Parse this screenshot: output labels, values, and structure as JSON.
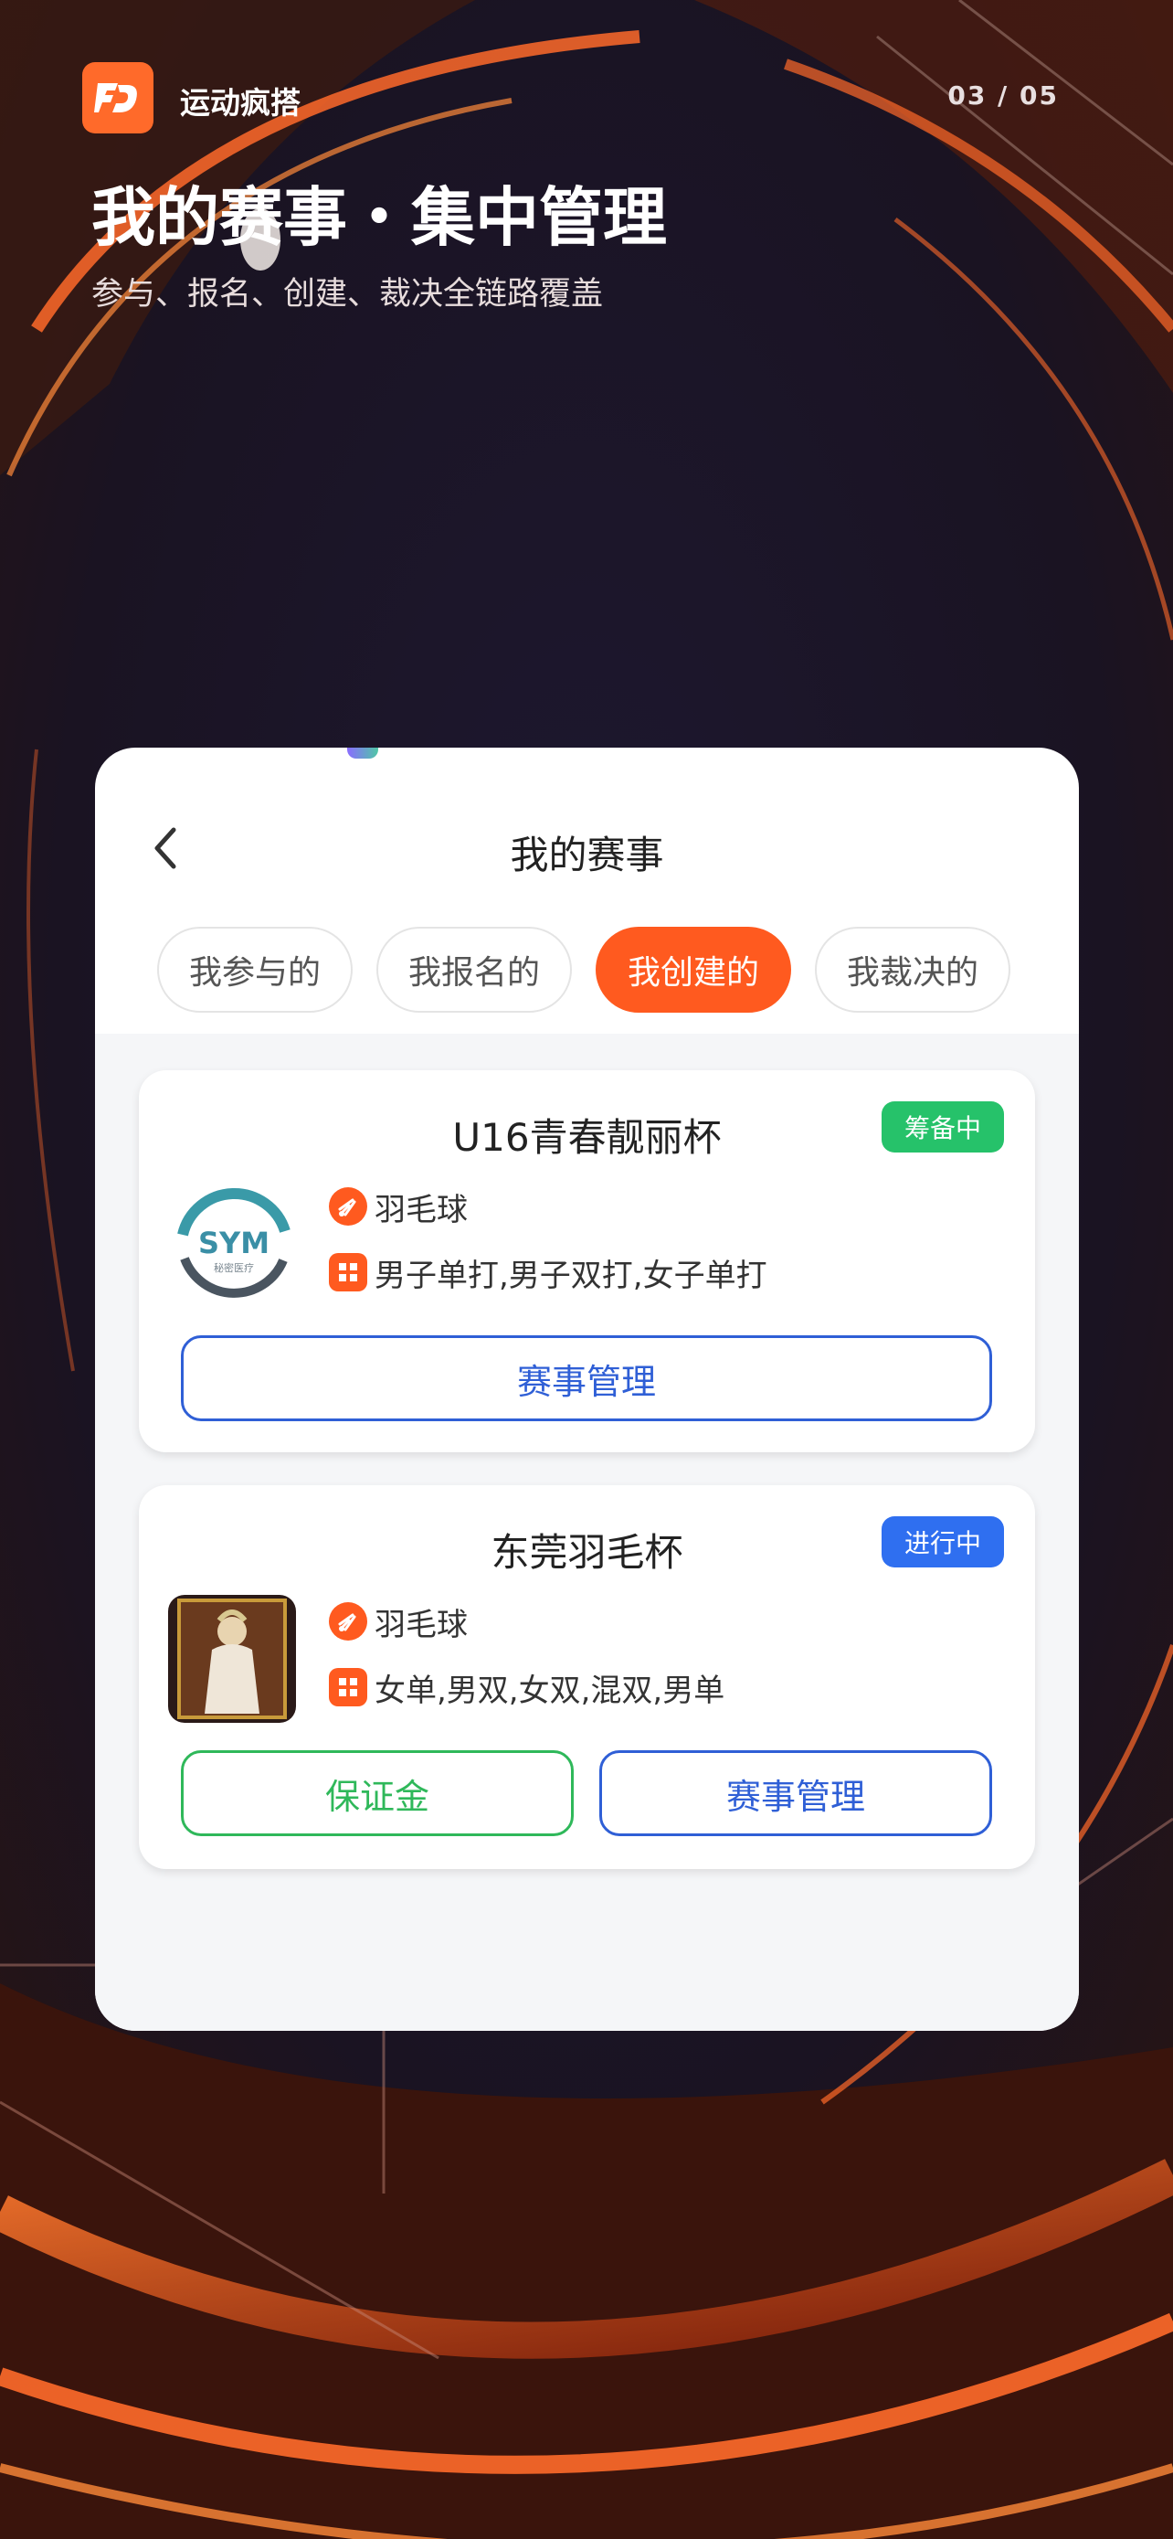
{
  "header": {
    "app_name": "运动疯搭",
    "page_indicator": "03 / 05",
    "title": "我的赛事・集中管理",
    "subtitle": "参与、报名、创建、裁决全链路覆盖"
  },
  "screen": {
    "title": "我的赛事",
    "tabs": [
      {
        "label": "我参与的",
        "active": false
      },
      {
        "label": "我报名的",
        "active": false
      },
      {
        "label": "我创建的",
        "active": true
      },
      {
        "label": "我裁决的",
        "active": false
      }
    ]
  },
  "events": [
    {
      "title": "U16青春靓丽杯",
      "status": "筹备中",
      "status_color": "#26c26a",
      "logo_text": "SYM",
      "logo_subtext": "秘密医疗",
      "sport": "羽毛球",
      "categories": "男子单打,男子双打,女子单打",
      "buttons": [
        "赛事管理"
      ]
    },
    {
      "title": "东莞羽毛杯",
      "status": "进行中",
      "status_color": "#2f6ff0",
      "sport": "羽毛球",
      "categories": "女单,男双,女双,混双,男单",
      "buttons": [
        "保证金",
        "赛事管理"
      ]
    }
  ],
  "colors": {
    "accent": "#ff5a1f",
    "primary_blue": "#2f5fd6",
    "success_green": "#2fb85a"
  }
}
